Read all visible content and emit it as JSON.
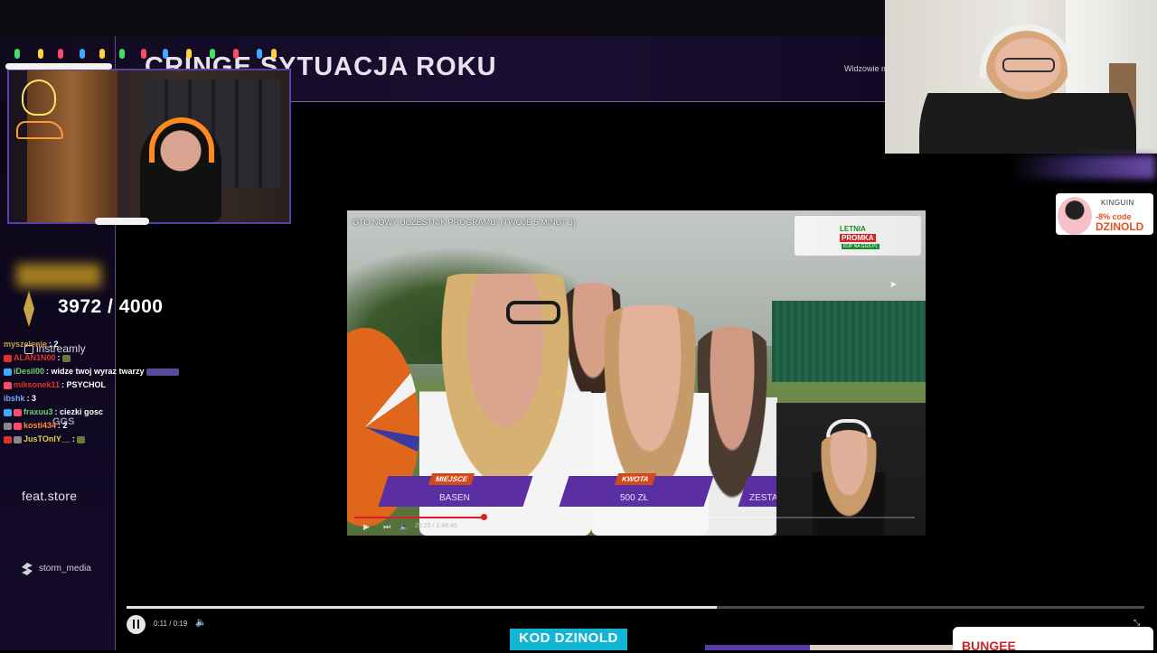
{
  "header": {
    "title": "CRINGE SYTUACJA ROKU",
    "right_text": "Widzowie mo"
  },
  "goal": {
    "current": "3972",
    "target": "4000",
    "text": "3972 / 4000"
  },
  "sponsors": {
    "instreamly": "instreamly",
    "ggs": "GGS",
    "featstore": "feat.store",
    "storm": "storm_media"
  },
  "chat": [
    {
      "user": "myszelenie",
      "message": "2",
      "color": "#c9a24a"
    },
    {
      "user": "ALAN1N00",
      "message": "",
      "color": "#e0322a"
    },
    {
      "user": "iDesil00",
      "message": "widze twoj wyraz twarzy",
      "color": "#6bd16b"
    },
    {
      "user": "miksonek11",
      "message": "PSYCHOL",
      "color": "#e0322a"
    },
    {
      "user": "ibshk",
      "message": "3",
      "color": "#7aa8ff"
    },
    {
      "user": "fraxuu3",
      "message": "ciezki gosc",
      "color": "#6bd16b"
    },
    {
      "user": "kosti434",
      "message": "2",
      "color": "#ff8a3a"
    },
    {
      "user": "JusTOnlY__",
      "message": "",
      "color": "#e0d24a"
    }
  ],
  "video": {
    "title": "OTO NOWY UCZESTNIK PROGRAMU! (TWOJE 5 MINUT 3)",
    "ad_line1": "LETNIA",
    "ad_line2": "PROMKA",
    "ad_line3": "KUP NA GGS.PL",
    "lower_thirds": [
      {
        "tag": "MIEJSCE",
        "value": "BASEN"
      },
      {
        "tag": "KWOTA",
        "value": "500 ZŁ"
      },
      {
        "tag": "",
        "value": "ZESTA"
      }
    ],
    "time": "25:23 / 1:49:45",
    "progress": 0.23
  },
  "player": {
    "time": "0:11 / 0:19",
    "progress": 0.58
  },
  "ads": {
    "kinguin_brand": "KINGUIN",
    "kinguin_discount": "-8% code",
    "kinguin_code": "DZINOLD",
    "kod": "KOD DZINOLD",
    "bungee": "BUNGEE"
  },
  "colors": {
    "accent_purple": "#5a2fa4",
    "kod_cyan": "#10b6d4",
    "video_red": "#d81f26"
  },
  "icons": [
    "pause-icon",
    "volume-icon",
    "play-icon",
    "next-icon",
    "expand-icon",
    "cursor-icon",
    "storm-icon",
    "instreamly-icon"
  ]
}
